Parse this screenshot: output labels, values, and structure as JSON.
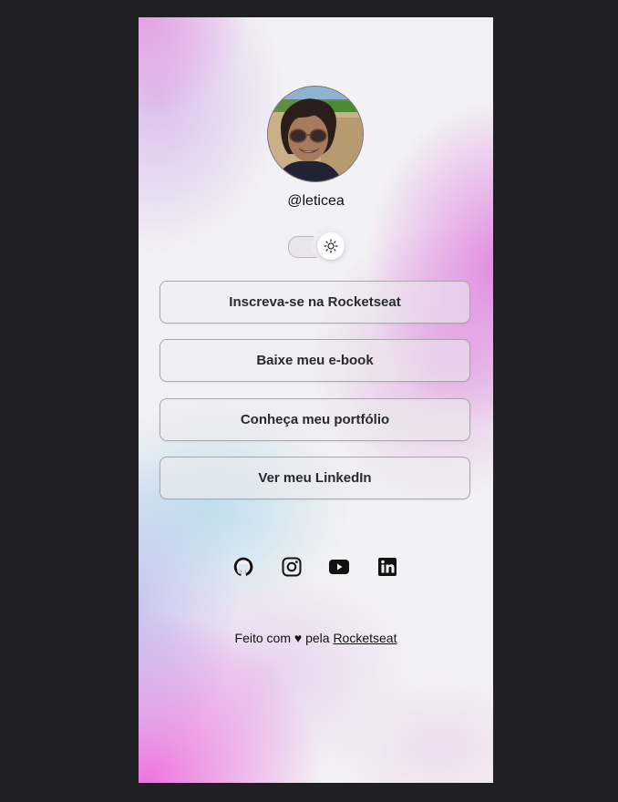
{
  "profile": {
    "username": "@leticea",
    "avatar_alt": "avatar"
  },
  "theme_toggle": {
    "icon": "sun-icon",
    "state": "light"
  },
  "links": [
    {
      "label": "Inscreva-se na Rocketseat"
    },
    {
      "label": "Baixe meu e-book"
    },
    {
      "label": "Conheça meu portfólio"
    },
    {
      "label": "Ver meu LinkedIn"
    }
  ],
  "social": [
    {
      "icon": "github-icon"
    },
    {
      "icon": "instagram-icon"
    },
    {
      "icon": "youtube-icon"
    },
    {
      "icon": "linkedin-icon"
    }
  ],
  "footer": {
    "text": "Feito com ♥ pela",
    "link_label": "Rocketseat"
  },
  "colors": {
    "page_background": "#202024",
    "card_background": "#f2f1f4",
    "accent_pink": "#e46ede"
  }
}
